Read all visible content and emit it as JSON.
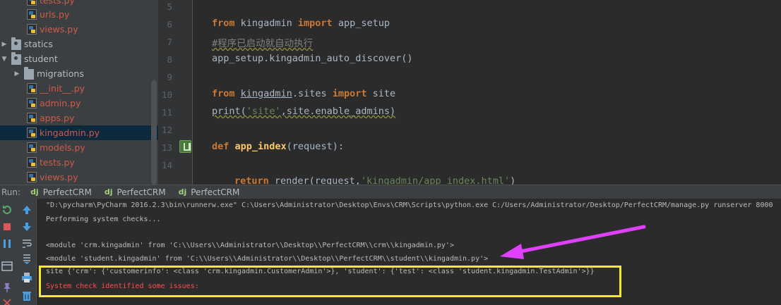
{
  "tree": {
    "items": [
      {
        "label": "tests.py",
        "type": "file",
        "color": "red"
      },
      {
        "label": "urls.py",
        "type": "file",
        "color": "red"
      },
      {
        "label": "views.py",
        "type": "file",
        "color": "red"
      },
      {
        "label": "statics",
        "type": "folder",
        "expanded": false
      },
      {
        "label": "student",
        "type": "folder",
        "expanded": true
      },
      {
        "label": "migrations",
        "type": "folder",
        "expanded": false
      },
      {
        "label": "__init__.py",
        "type": "file",
        "color": "red"
      },
      {
        "label": "admin.py",
        "type": "file",
        "color": "red"
      },
      {
        "label": "apps.py",
        "type": "file",
        "color": "red"
      },
      {
        "label": "kingadmin.py",
        "type": "file",
        "color": "red",
        "selected": true
      },
      {
        "label": "models.py",
        "type": "file",
        "color": "red"
      },
      {
        "label": "tests.py",
        "type": "file",
        "color": "red"
      },
      {
        "label": "views.py",
        "type": "file",
        "color": "red"
      }
    ]
  },
  "editor": {
    "line_numbers": [
      "5",
      "6",
      "7",
      "8",
      "9",
      "10",
      "11",
      "12",
      "13",
      "14"
    ],
    "code": {
      "l6_from": "from",
      "l6_mod": " kingadmin ",
      "l6_import": "import",
      "l6_name": " app_setup",
      "l7_comment": "#程序已启动就自动执行",
      "l8": "app_setup.kingadmin_auto_discover()",
      "l10_from": "from",
      "l10_mod": "kingadmin",
      "l10_rest": ".sites ",
      "l10_import": "import",
      "l10_name": " site",
      "l11_print": "print(",
      "l11_str": "'site'",
      "l11_rest": ",site.enable_admins)",
      "l13_def": "def",
      "l13_fn": " app_index",
      "l13_rest": "(request):",
      "l15_return": "return",
      "l15_rest": " render(request,",
      "l15_str": "'kingadmin/app_index.html'",
      "l15_end": ")"
    }
  },
  "run": {
    "label": "Run:",
    "tabs": [
      "PerfectCRM",
      "PerfectCRM",
      "PerfectCRM"
    ],
    "tab_icon": "dj"
  },
  "console": {
    "lines": [
      "\"D:\\pycharm\\PyCharm 2016.2.3\\bin\\runnerw.exe\" C:\\Users\\Administrator\\Desktop\\Envs\\CRM\\Scripts\\python.exe C:/Users/Administrator/Desktop/PerfectCRM/manage.py runserver 8000",
      "Performing system checks...",
      "",
      "<module 'crm.kingadmin' from 'C:\\\\Users\\\\Administrator\\\\Desktop\\\\PerfectCRM\\\\crm\\\\kingadmin.py'>",
      "<module 'student.kingadmin' from 'C:\\\\Users\\\\Administrator\\\\Desktop\\\\PerfectCRM\\\\student\\\\kingadmin.py'>",
      "site {'crm': {'customerinfo': <class 'crm.kingadmin.CustomerAdmin'>}, 'student': {'test': <class 'student.kingadmin.TestAdmin'>}}",
      "System check identified some issues:"
    ]
  },
  "colors": {
    "highlight_box": "#f3ea2a",
    "annotation_arrow": "#e040fb",
    "error_text": "#ff4e4e"
  },
  "icons": [
    "rerun-icon",
    "stop-icon",
    "pause-icon",
    "layout-icon",
    "pin-icon",
    "close-icon",
    "scroll-up-icon",
    "scroll-down-icon",
    "soft-wrap-icon",
    "print-icon",
    "trash-icon"
  ]
}
